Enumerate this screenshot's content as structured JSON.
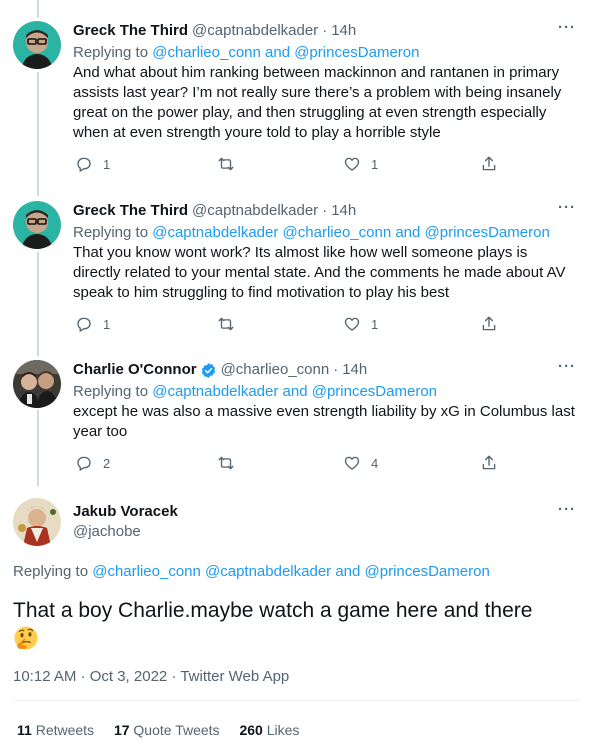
{
  "replies": [
    {
      "name": "Greck The Third",
      "handle": "@captnabdelkader",
      "time": "14h",
      "replying_prefix": "Replying to ",
      "replying_links": "@charlieo_conn and @princesDameron",
      "lines": [
        "And what about him ranking between mackinnon and rantanen in primary",
        "assists last year? I’m not really sure there’s a problem with being insanely",
        "great on the power play, and then struggling at even strength especially",
        "when at even strength youre told to play a horrible style"
      ],
      "reply_count": "1",
      "retweet_count": "",
      "like_count": "1"
    },
    {
      "name": "Greck The Third",
      "handle": "@captnabdelkader",
      "time": "14h",
      "replying_prefix": "Replying to ",
      "replying_links": "@captnabdelkader @charlieo_conn and @princesDameron",
      "lines": [
        "That you know wont work? Its almost like how well someone plays is",
        "directly related to your mental state. And the comments he made about AV",
        "speak to him struggling to find motivation to play his best"
      ],
      "reply_count": "1",
      "retweet_count": "",
      "like_count": "1"
    },
    {
      "name": "Charlie O'Connor",
      "handle": "@charlieo_conn",
      "time": "14h",
      "verified": true,
      "replying_prefix": "Replying to ",
      "replying_links": "@captnabdelkader and @princesDameron",
      "lines": [
        "except he was also a massive even strength liability by xG in Columbus last",
        "year too"
      ],
      "reply_count": "2",
      "retweet_count": "",
      "like_count": "4"
    }
  ],
  "main": {
    "name": "Jakub Voracek",
    "handle": "@jachobe",
    "replying_prefix": "Replying to ",
    "replying_links": "@charlieo_conn @captnabdelkader and @princesDameron",
    "text": "That a boy Charlie.maybe watch a game here and there",
    "emoji": "thinking-face",
    "meta": "10:12 AM · Oct 3, 2022 · Twitter Web App",
    "retweets_count": "11",
    "retweets_label": "Retweets",
    "quotes_count": "17",
    "quotes_label": "Quote Tweets",
    "likes_count": "260",
    "likes_label": "Likes"
  },
  "colors": {
    "link": "#1d9bf0",
    "secondary": "#536471",
    "verified": "#1d9bf0"
  }
}
